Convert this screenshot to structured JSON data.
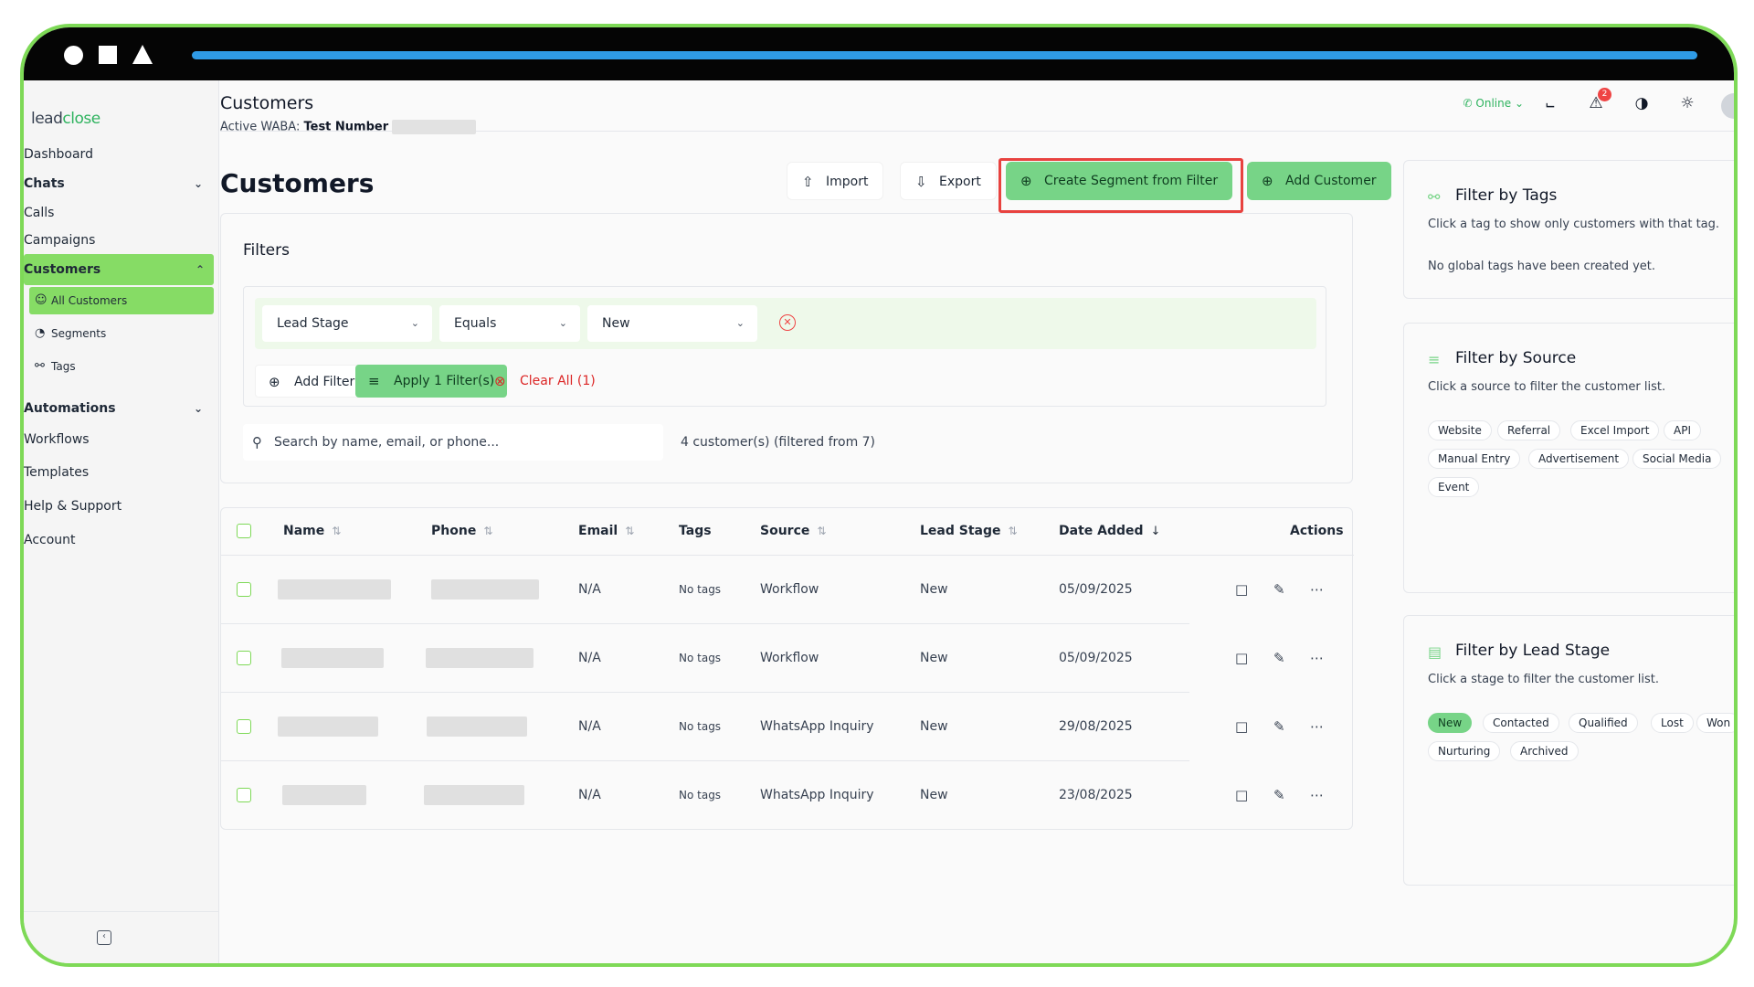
{
  "brand": {
    "logo_prefix": "lead",
    "logo_suffix": "close",
    "accent": "#77d487",
    "sidebar_active": "#86dc65",
    "frame": "#7ed957"
  },
  "sidebar": {
    "items": [
      {
        "label": "Dashboard"
      },
      {
        "label": "Chats"
      },
      {
        "label": "Calls"
      },
      {
        "label": "Campaigns"
      },
      {
        "label": "Customers"
      },
      {
        "label": "Automations"
      },
      {
        "label": "Workflows"
      },
      {
        "label": "Templates"
      },
      {
        "label": "Help & Support"
      },
      {
        "label": "Account"
      }
    ],
    "customers_sub": [
      {
        "label": "All Customers",
        "icon": "users-icon"
      },
      {
        "label": "Segments",
        "icon": "pie-icon"
      },
      {
        "label": "Tags",
        "icon": "tag-icon"
      }
    ]
  },
  "header": {
    "title": "Customers",
    "waba_label": "Active WABA:",
    "waba_value": "Test Number",
    "status": "Online",
    "notification_count": "2"
  },
  "main": {
    "title": "Customers",
    "import_label": "Import",
    "export_label": "Export",
    "create_segment_label": "Create Segment from Filter",
    "add_customer_label": "Add Customer",
    "filters_title": "Filters",
    "filter": {
      "field": "Lead Stage",
      "operator": "Equals",
      "value": "New"
    },
    "add_filter_label": "Add Filter",
    "apply_label": "Apply 1 Filter(s)",
    "clear_label": "Clear All (1)",
    "search_placeholder": "Search by name, email, or phone...",
    "count_text": "4 customer(s) (filtered from 7)"
  },
  "table": {
    "headers": {
      "name": "Name",
      "phone": "Phone",
      "email": "Email",
      "tags": "Tags",
      "source": "Source",
      "lead_stage": "Lead Stage",
      "date_added": "Date Added",
      "actions": "Actions"
    },
    "rows": [
      {
        "email": "N/A",
        "tags": "No tags",
        "source": "Workflow",
        "stage": "New",
        "date": "05/09/2025"
      },
      {
        "email": "N/A",
        "tags": "No tags",
        "source": "Workflow",
        "stage": "New",
        "date": "05/09/2025"
      },
      {
        "email": "N/A",
        "tags": "No tags",
        "source": "WhatsApp Inquiry",
        "stage": "New",
        "date": "29/08/2025"
      },
      {
        "email": "N/A",
        "tags": "No tags",
        "source": "WhatsApp Inquiry",
        "stage": "New",
        "date": "23/08/2025"
      }
    ]
  },
  "right": {
    "tags": {
      "title": "Filter by Tags",
      "desc": "Click a tag to show only customers with that tag.",
      "empty": "No global tags have been created yet."
    },
    "source": {
      "title": "Filter by Source",
      "desc": "Click a source to filter the customer list.",
      "chips": [
        "Website",
        "Referral",
        "Excel Import",
        "API",
        "Manual Entry",
        "Advertisement",
        "Social Media",
        "Event"
      ]
    },
    "stage": {
      "title": "Filter by Lead Stage",
      "desc": "Click a stage to filter the customer list.",
      "chips": [
        "New",
        "Contacted",
        "Qualified",
        "Lost",
        "Won",
        "Nurturing",
        "Archived"
      ]
    }
  }
}
